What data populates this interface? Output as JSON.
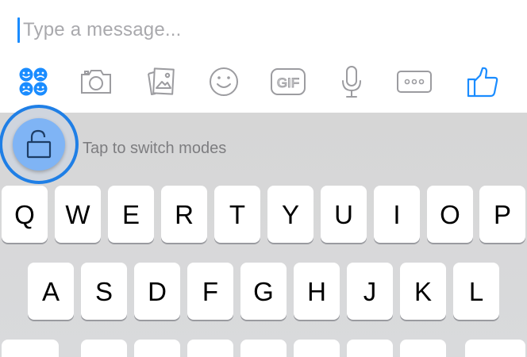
{
  "composer": {
    "placeholder": "Type a message...",
    "accent_color": "#1a8cff",
    "tools": [
      {
        "icon": "emoji-faces-icon"
      },
      {
        "icon": "camera-icon"
      },
      {
        "icon": "photo-gallery-icon"
      },
      {
        "icon": "smiley-icon"
      },
      {
        "icon": "gif-icon",
        "label": "GIF"
      },
      {
        "icon": "microphone-icon"
      },
      {
        "icon": "more-icon"
      },
      {
        "icon": "thumbs-up-icon"
      }
    ]
  },
  "keyboard": {
    "hint": "Tap to switch modes",
    "mode_icon": "unlock-icon",
    "row1": [
      "Q",
      "W",
      "E",
      "R",
      "T",
      "Y",
      "U",
      "I",
      "O",
      "P"
    ],
    "row2": [
      "A",
      "S",
      "D",
      "F",
      "G",
      "H",
      "J",
      "K",
      "L"
    ]
  }
}
